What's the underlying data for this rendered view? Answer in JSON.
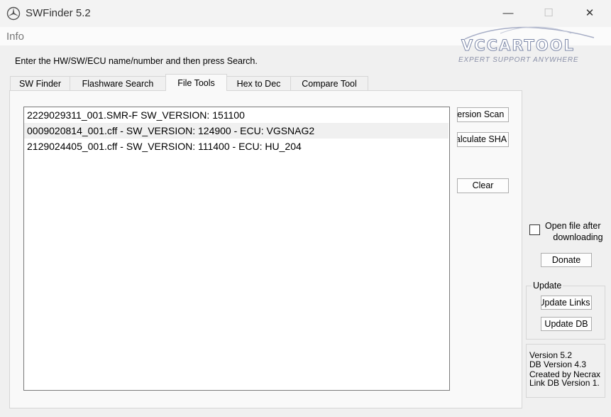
{
  "window": {
    "title": "SWFinder 5.2",
    "controls": {
      "minimize": "—",
      "maximize": "☐",
      "close": "✕"
    }
  },
  "menu": {
    "info": "Info"
  },
  "brand": {
    "name": "VCCARTOOL",
    "tagline": "EXPERT SUPPORT ANYWHERE"
  },
  "instruction": "Enter the HW/SW/ECU name/number and then press Search.",
  "tabs": [
    {
      "label": "SW Finder"
    },
    {
      "label": "Flashware Search"
    },
    {
      "label": "File Tools"
    },
    {
      "label": "Hex to Dec"
    },
    {
      "label": "Compare Tool"
    }
  ],
  "results": [
    "2229029311_001.SMR-F SW_VERSION: 151100",
    "0009020814_001.cff - SW_VERSION: 124900 - ECU: VGSNAG2",
    "2129024405_001.cff - SW_VERSION: 111400 - ECU: HU_204"
  ],
  "buttons": {
    "version_scan": "Version Scan",
    "calculate_sha": "Calculate SHA",
    "clear": "Clear",
    "donate": "Donate",
    "update_links": "Update Links",
    "update_db": "Update DB"
  },
  "open_file": {
    "label_line1": "Open file after",
    "label_line2": "downloading",
    "checked": false
  },
  "update_group": {
    "legend": "Update"
  },
  "info": {
    "version": "Version 5.2",
    "db_version": "DB Version 4.3",
    "created_by": "Created by Necrax",
    "link_db_version": "Link DB Version 1."
  },
  "colors": {
    "accent_selected": "#f0f0f0",
    "brand": "#7d88a8"
  }
}
